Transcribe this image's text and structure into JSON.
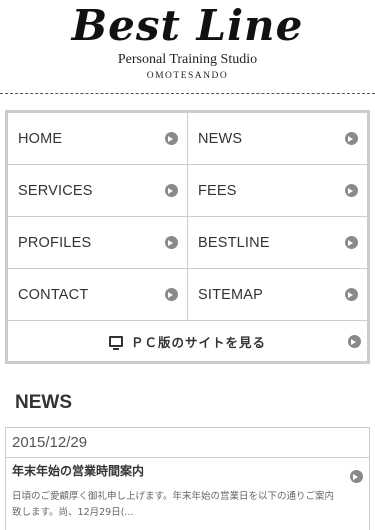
{
  "header": {
    "logo_text": "Best Line",
    "tagline": "Personal Training Studio",
    "location": "OMOTESANDO"
  },
  "menu": {
    "items": [
      {
        "label": "HOME"
      },
      {
        "label": "NEWS"
      },
      {
        "label": "SERVICES"
      },
      {
        "label": "FEES"
      },
      {
        "label": "PROFILES"
      },
      {
        "label": "BESTLINE"
      },
      {
        "label": "CONTACT"
      },
      {
        "label": "SITEMAP"
      }
    ],
    "pc_link": "ＰＣ版のサイトを見る"
  },
  "news": {
    "heading": "NEWS",
    "items": [
      {
        "date": "2015/12/29",
        "title": "年末年始の営業時間案内",
        "excerpt": "日頃のご愛顧厚く御礼申し上げます。年末年始の営業日を以下の通りご案内致します。尚、12月29日(..."
      }
    ]
  },
  "icons": {
    "arrow": "circle-chevron-right-icon",
    "pc": "monitor-icon"
  }
}
